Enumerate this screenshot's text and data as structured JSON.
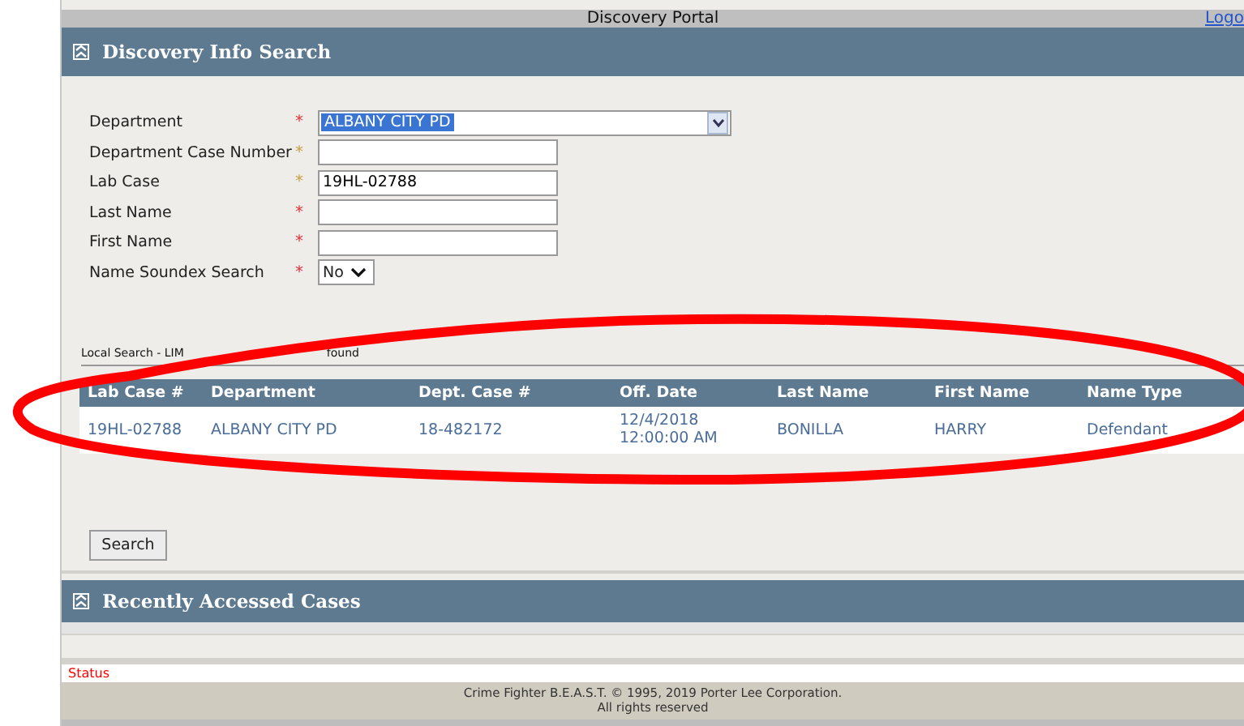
{
  "top_bar": {
    "title": "Discovery Portal",
    "link": "Logo"
  },
  "search_panel": {
    "title": "Discovery Info Search",
    "fields": [
      {
        "label": "Department",
        "mark": "*",
        "kind": "select",
        "value": "ALBANY CITY PD",
        "color": "#e0303a"
      },
      {
        "label": "Department Case Number",
        "mark": "*",
        "kind": "text",
        "color": "#c8a040"
      },
      {
        "label": "Lab Case",
        "mark": "*",
        "kind": "text",
        "value": "19HL-02788",
        "color": "#c8a040"
      },
      {
        "label": "Last Name",
        "mark": "*",
        "kind": "text",
        "color": "#e0303a"
      },
      {
        "label": "First Name",
        "mark": "*",
        "kind": "text",
        "color": "#e0303a"
      },
      {
        "label": "Name Soundex Search",
        "mark": "*",
        "kind": "small_select",
        "value": "No",
        "color": "#e0303a"
      }
    ],
    "results_caption": [
      "Local Search - LIM",
      "found"
    ],
    "table": {
      "columns": [
        "Lab Case #",
        "Department",
        "Dept. Case #",
        "Off. Date",
        "Last Name",
        "First Name",
        "Name Type"
      ],
      "rows": [
        [
          "19HL-02788",
          "ALBANY CITY PD",
          "18-482172",
          "12/4/2018 12:00:00 AM",
          "BONILLA",
          "HARRY",
          "Defendant"
        ]
      ]
    },
    "button": "Search"
  },
  "recent_panel": {
    "title": "Recently Accessed Cases"
  },
  "status": "Status",
  "footer": [
    "Crime Fighter B.E.A.S.T. © 1995, 2019 Porter Lee Corporation.",
    "All rights reserved"
  ]
}
